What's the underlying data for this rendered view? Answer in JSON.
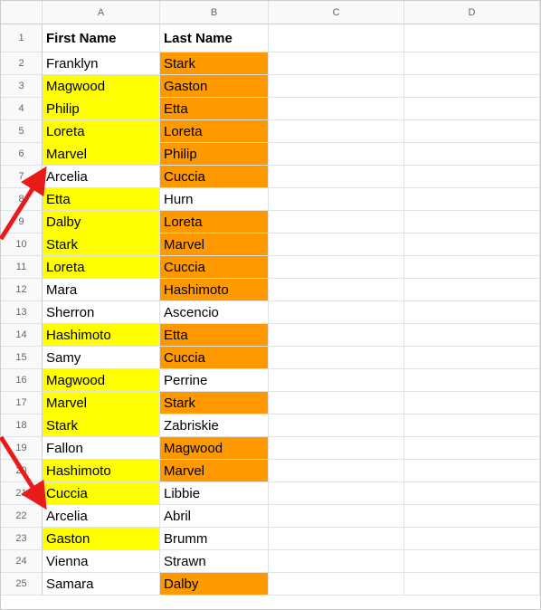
{
  "columns": [
    "A",
    "B",
    "C",
    "D"
  ],
  "data": {
    "headers": {
      "a": "First Name",
      "b": "Last Name"
    },
    "rows": [
      {
        "n": "1"
      },
      {
        "n": "2",
        "a": "Franklyn",
        "b": "Stark",
        "bc": "orange"
      },
      {
        "n": "3",
        "a": "Magwood",
        "ac": "yellow",
        "b": "Gaston",
        "bc": "orange"
      },
      {
        "n": "4",
        "a": "Philip",
        "ac": "yellow",
        "b": "Etta",
        "bc": "orange"
      },
      {
        "n": "5",
        "a": "Loreta",
        "ac": "yellow",
        "b": "Loreta",
        "bc": "orange"
      },
      {
        "n": "6",
        "a": "Marvel",
        "ac": "yellow",
        "b": "Philip",
        "bc": "orange"
      },
      {
        "n": "7",
        "a": "Arcelia",
        "b": "Cuccia",
        "bc": "orange"
      },
      {
        "n": "8",
        "a": "Etta",
        "ac": "yellow",
        "b": "Hurn"
      },
      {
        "n": "9",
        "a": "Dalby",
        "ac": "yellow",
        "b": "Loreta",
        "bc": "orange"
      },
      {
        "n": "10",
        "a": "Stark",
        "ac": "yellow",
        "b": "Marvel",
        "bc": "orange"
      },
      {
        "n": "11",
        "a": "Loreta",
        "ac": "yellow",
        "b": "Cuccia",
        "bc": "orange"
      },
      {
        "n": "12",
        "a": "Mara",
        "b": "Hashimoto",
        "bc": "orange"
      },
      {
        "n": "13",
        "a": "Sherron",
        "b": "Ascencio"
      },
      {
        "n": "14",
        "a": "Hashimoto",
        "ac": "yellow",
        "b": "Etta",
        "bc": "orange"
      },
      {
        "n": "15",
        "a": "Samy",
        "b": "Cuccia",
        "bc": "orange"
      },
      {
        "n": "16",
        "a": "Magwood",
        "ac": "yellow",
        "b": "Perrine"
      },
      {
        "n": "17",
        "a": "Marvel",
        "ac": "yellow",
        "b": "Stark",
        "bc": "orange"
      },
      {
        "n": "18",
        "a": "Stark",
        "ac": "yellow",
        "b": "Zabriskie"
      },
      {
        "n": "19",
        "a": "Fallon",
        "b": "Magwood",
        "bc": "orange"
      },
      {
        "n": "20",
        "a": "Hashimoto",
        "ac": "yellow",
        "b": "Marvel",
        "bc": "orange"
      },
      {
        "n": "21",
        "a": "Cuccia",
        "ac": "yellow",
        "b": "Libbie"
      },
      {
        "n": "22",
        "a": "Arcelia",
        "b": "Abril"
      },
      {
        "n": "23",
        "a": "Gaston",
        "ac": "yellow",
        "b": "Brumm"
      },
      {
        "n": "24",
        "a": "Vienna",
        "b": "Strawn"
      },
      {
        "n": "25",
        "a": "Samara",
        "b": "Dalby",
        "bc": "orange"
      }
    ]
  }
}
